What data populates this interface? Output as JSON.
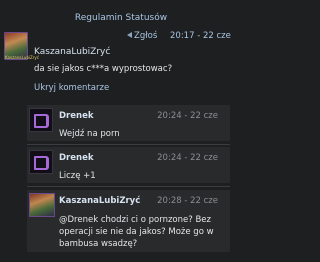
{
  "header": {
    "link_label": "Regulamin Statusów"
  },
  "main_comment": {
    "avatar_label": "KaszanaLubiZryć",
    "report_label": "Zgłoś",
    "time": "20:17 - 22 cze",
    "author": "KaszanaLubiZryć",
    "text": "da sie jakos c***a wyprostowac?",
    "hide_label": "Ukryj komentarze"
  },
  "replies": [
    {
      "author": "Drenek",
      "time": "20:24 - 22 cze",
      "text": "Wejdź na porn",
      "avatar_icon": "drenek-logo-icon"
    },
    {
      "author": "Drenek",
      "time": "20:24 - 22 cze",
      "text": "Liczę +1",
      "avatar_icon": "drenek-logo-icon"
    },
    {
      "author": "KaszanaLubiZryć",
      "time": "20:28 - 22 cze",
      "text": "@Drenek chodzi ci o pornzone? Bez operacji sie nie da jakos? Może go w bambusa wsadzę?",
      "avatar_icon": "user-avatar-image"
    }
  ],
  "colors": {
    "background": "#1e1f20",
    "reply_background": "#282a2c",
    "link": "#a9c6e5",
    "accent_purple": "#a66ad8"
  }
}
